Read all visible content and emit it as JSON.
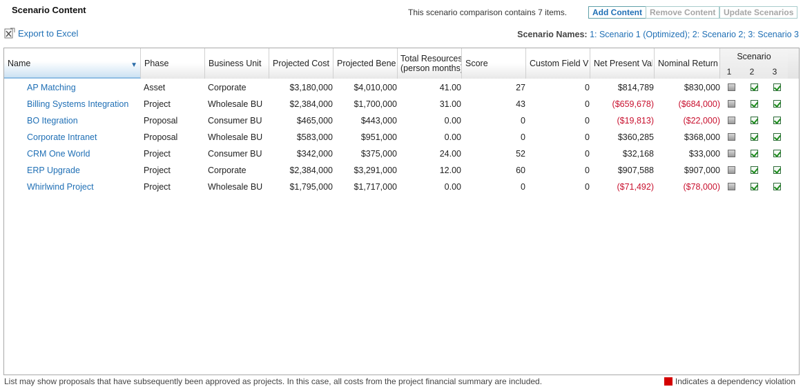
{
  "header": {
    "title": "Scenario Content",
    "count_text": "This scenario comparison contains 7 items.",
    "add_label": "Add Content",
    "remove_label": "Remove Content",
    "update_label": "Update Scenarios"
  },
  "toolbar": {
    "export_label": "Export to Excel",
    "export_icon": "excel-export-icon"
  },
  "scenario_names": {
    "label": "Scenario Names:",
    "value": "1: Scenario 1 (Optimized); 2: Scenario 2; 3: Scenario 3"
  },
  "columns": {
    "name": "Name",
    "phase": "Phase",
    "business_unit": "Business Unit",
    "projected_cost": "Projected Cost",
    "projected_benefit": "Projected Benefit",
    "total_resources_1": "Total Resources",
    "total_resources_2": "(person months)",
    "score": "Score",
    "custom_field": "Custom Field Value",
    "npv": "Net Present Value",
    "nominal_return": "Nominal Return",
    "scenario_group": "Scenario",
    "scenario_nums": [
      "1",
      "2",
      "3"
    ],
    "sort_icon": "sort-descending-icon"
  },
  "rows": [
    {
      "name": "AP Matching",
      "phase": "Asset",
      "bu": "Corporate",
      "cost": "$3,180,000",
      "benefit": "$4,010,000",
      "resources": "41.00",
      "score": "27",
      "custom": "0",
      "npv": "$814,789",
      "npv_neg": false,
      "nominal": "$830,000",
      "nominal_neg": false,
      "s1": false,
      "s2": true,
      "s3": true
    },
    {
      "name": "Billing Systems Integration",
      "phase": "Project",
      "bu": "Wholesale BU",
      "cost": "$2,384,000",
      "benefit": "$1,700,000",
      "resources": "31.00",
      "score": "43",
      "custom": "0",
      "npv": "($659,678)",
      "npv_neg": true,
      "nominal": "($684,000)",
      "nominal_neg": true,
      "s1": false,
      "s2": true,
      "s3": true
    },
    {
      "name": "BO Itegration",
      "phase": "Proposal",
      "bu": "Consumer BU",
      "cost": "$465,000",
      "benefit": "$443,000",
      "resources": "0.00",
      "score": "0",
      "custom": "0",
      "npv": "($19,813)",
      "npv_neg": true,
      "nominal": "($22,000)",
      "nominal_neg": true,
      "s1": false,
      "s2": true,
      "s3": true
    },
    {
      "name": "Corporate Intranet",
      "phase": "Proposal",
      "bu": "Wholesale BU",
      "cost": "$583,000",
      "benefit": "$951,000",
      "resources": "0.00",
      "score": "0",
      "custom": "0",
      "npv": "$360,285",
      "npv_neg": false,
      "nominal": "$368,000",
      "nominal_neg": false,
      "s1": false,
      "s2": true,
      "s3": true
    },
    {
      "name": "CRM One World",
      "phase": "Project",
      "bu": "Consumer BU",
      "cost": "$342,000",
      "benefit": "$375,000",
      "resources": "24.00",
      "score": "52",
      "custom": "0",
      "npv": "$32,168",
      "npv_neg": false,
      "nominal": "$33,000",
      "nominal_neg": false,
      "s1": false,
      "s2": true,
      "s3": true
    },
    {
      "name": "ERP Upgrade",
      "phase": "Project",
      "bu": "Corporate",
      "cost": "$2,384,000",
      "benefit": "$3,291,000",
      "resources": "12.00",
      "score": "60",
      "custom": "0",
      "npv": "$907,588",
      "npv_neg": false,
      "nominal": "$907,000",
      "nominal_neg": false,
      "s1": false,
      "s2": true,
      "s3": true
    },
    {
      "name": "Whirlwind Project",
      "phase": "Project",
      "bu": "Wholesale BU",
      "cost": "$1,795,000",
      "benefit": "$1,717,000",
      "resources": "0.00",
      "score": "0",
      "custom": "0",
      "npv": "($71,492)",
      "npv_neg": true,
      "nominal": "($78,000)",
      "nominal_neg": true,
      "s1": false,
      "s2": true,
      "s3": true
    }
  ],
  "footer": {
    "note": "List may show proposals that have subsequently been approved as projects. In this case, all costs from the project financial summary are included.",
    "legend": "Indicates a dependency violation",
    "legend_color": "#d40000"
  },
  "colors": {
    "link": "#1f6fb5",
    "negative": "#c8102e"
  }
}
